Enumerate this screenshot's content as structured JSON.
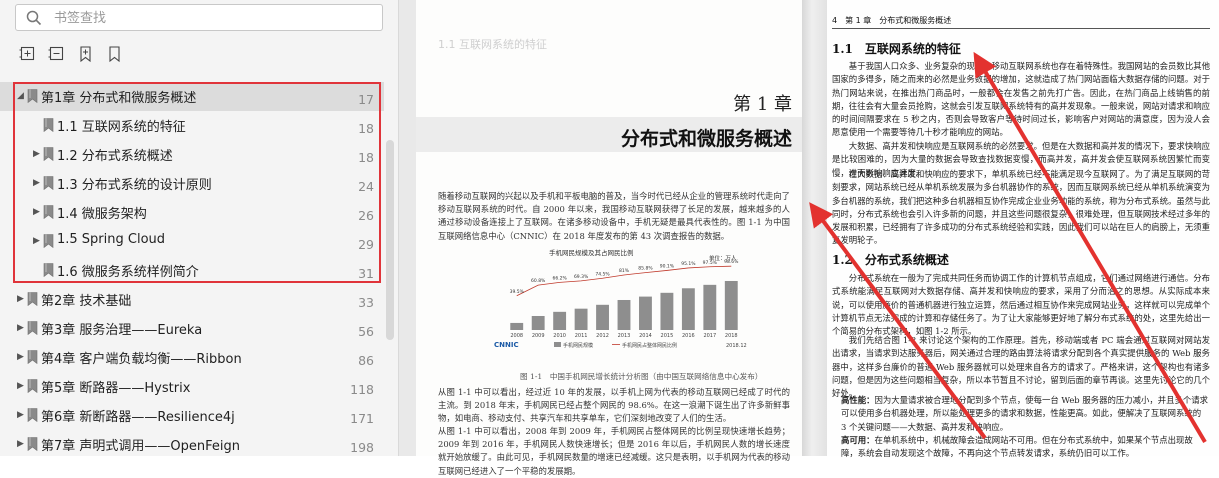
{
  "search": {
    "placeholder": "书签查找"
  },
  "toolbar": [
    {
      "icon": "expand-all-icon"
    },
    {
      "icon": "collapse-all-icon"
    },
    {
      "icon": "add-bookmark-icon"
    },
    {
      "icon": "bookmark-icon"
    }
  ],
  "toc": [
    {
      "label": "第1章 分布式和微服务概述",
      "page": "17",
      "level": 0,
      "expanded": true,
      "selected": true
    },
    {
      "label": "1.1 互联网系统的特征",
      "page": "18",
      "level": 1,
      "has_children": false
    },
    {
      "label": "1.2 分布式系统概述",
      "page": "18",
      "level": 1,
      "has_children": true
    },
    {
      "label": "1.3 分布式系统的设计原则",
      "page": "24",
      "level": 1,
      "has_children": true
    },
    {
      "label": "1.4 微服务架构",
      "page": "26",
      "level": 1,
      "has_children": true
    },
    {
      "label": "1.5 Spring Cloud",
      "page": "29",
      "level": 1,
      "has_children": true
    },
    {
      "label": "1.6 微服务系统样例简介",
      "page": "31",
      "level": 1,
      "has_children": false
    },
    {
      "label": "第2章 技术基础",
      "page": "33",
      "level": 0,
      "has_children": true
    },
    {
      "label": "第3章 服务治理——Eureka",
      "page": "56",
      "level": 0,
      "has_children": true
    },
    {
      "label": "第4章 客户端负载均衡——Ribbon",
      "page": "86",
      "level": 0,
      "has_children": true
    },
    {
      "label": "第5章 断路器——Hystrix",
      "page": "118",
      "level": 0,
      "has_children": true
    },
    {
      "label": "第6章 新断路器——Resilience4j",
      "page": "171",
      "level": 0,
      "has_children": true
    },
    {
      "label": "第7章 声明式调用——OpenFeign",
      "page": "198",
      "level": 0,
      "has_children": true
    }
  ],
  "colors": {
    "highlight": "#e0343a",
    "sidebar_bg": "#f4f4f4",
    "selected_row": "#dcdcdc"
  },
  "left_page": {
    "chapter_no": "第 1 章",
    "chapter_title": "分布式和微服务概述",
    "top_text": "1.1 互联网系统的特征",
    "intro": "随着移动互联网的兴起以及手机和平板电脑的普及，当今时代已经从企业的管理系统时代走向了移动互联网系统的时代。自 2000 年以来，我国移动互联网获得了长足的发展，越来越多的人通过移动设备连接上了互联网。在诸多移动设备中，手机无疑是最具代表性的。图 1-1 为中国互联网络信息中心（CNNIC）在 2018 年度发布的第 43 次调查报告的数据。",
    "chart_title": "手机网民规模及其占网民比例",
    "chart_unit": "单位：万人",
    "chart_logo": "CNNIC",
    "chart_legend": [
      "手机网民规模",
      "手机网民占整体网民比例"
    ],
    "chart_date": "2018.12",
    "figure_caption": "图 1-1　中国手机网民增长统计分析图（由中国互联网络信息中心发布）",
    "para2": "从图 1-1 中可以看出，经过近 10 年的发展，以手机上网为代表的移动互联网已经成了时代的主流。到 2018 年末，手机网民已经占整个网民的 98.6%。在这一浪潮下诞生出了许多新鲜事物，如电商、移动支付、共享汽车和共享单车，它们深刻地改变了人们的生活。",
    "para3": "从图 1-1 中可以看出，2008 年到 2009 年，手机网民占整体网民的比例呈现快速增长趋势；2009 年到 2016 年，手机网民人数快速增长；但是 2016 年以后，手机网民人数的增长速度就开始放缓了。由此可见，手机网民数量的增速已经减缓。这只是表明，以手机网为代表的移动互联网已经进入了一个平稳的发展期。"
  },
  "chart_data": {
    "type": "bar",
    "title": "手机网民规模及其占网民比例",
    "categories": [
      "2008",
      "2009",
      "2010",
      "2011",
      "2012",
      "2013",
      "2014",
      "2015",
      "2016",
      "2017",
      "2018"
    ],
    "series": [
      {
        "name": "手机网民规模",
        "values": [
          11760,
          23344,
          30274,
          35558,
          41997,
          50006,
          55678,
          61981,
          69531,
          75265,
          81698
        ]
      },
      {
        "name": "手机网民占整体网民比例",
        "values": [
          39.5,
          60.8,
          66.2,
          69.3,
          74.5,
          81.0,
          85.8,
          90.1,
          95.1,
          97.5,
          98.6
        ]
      }
    ]
  },
  "right_page": {
    "header": "4　第 1 章　分布式和微服务概述",
    "section1": "1.1　互联网系统的特征",
    "s1_p1": "基于我国人口众多、业务复杂的现状，移动互联网系统也存在着特殊性。我国网站的会员数比其他国家的多得多，随之而来的必然是业务数据的增加，这就造成了热门网站面临大数据存储的问题。对于热门网站来说，在推出热门商品时，一般都会在发售之前先打广告。因此，在热门商品上线销售的前期，往往会有大量会员抢购，这就会引发互联网系统特有的高并发现象。一般来说，网站对请求和响应的时间间隔要求在 5 秒之内，否则会导致客户等待时间过长，影响客户对网站的满意度，因为没人会愿意使用一个需要等待几十秒才能响应的网站。",
    "s1_p2": "大数据、高并发和快响应是互联网系统的必然要求。但是在大数据和高并发的情况下，要求快响应是比较困难的，因为大量的数据会导致查找数据变慢，而高并发，高并发会使互联网系统因繁忙而变慢，进而影响响应速度。",
    "s1_p3": "在大数据、高并发和快响应的要求下，单机系统已经不能满足现今互联网了。为了满足互联网的苛刻要求，网站系统已经从单机系统发展为多台机器协作的系统，因而互联网系统已经从单机系统演变为多台机器的系统，我们把这种多台机器相互协作完成企业业务功能的系统，称为分布式系统。虽然与此同时，分布式系统也会引入许多新的问题，并且这些问题很复杂，很难处理，但互联网技术经过多年的发展和积累，已经拥有了许多成功的分布式系统经验和实践，因此我们可以站在巨人的肩膀上，无须重复发明轮子。",
    "section2": "1.2　分布式系统概述",
    "s2_p1": "分布式系统在一般为了完成共同任务而协调工作的计算机节点组成，它们通过网络进行通信。分布式系统能满足互联网对大数据存储、高并发和快响应的要求，采用了分而治之的思想。从实际成本来说，可以使用廉价的普通机器进行独立运算，然后通过相互协作来完成网站业务，这样就可以完成单个计算机节点无法完成的计算和存储任务了。为了让大家能够更好地了解分布式系统的处，这里先给出一个简易的分布式架构，如图 1-2 所示。",
    "s2_p2": "我们先结合图 1-2 来讨论这个架构的工作原理。首先，移动端或者 PC 端会通过互联网对网站发出请求，当请求到达服务器后，网关通过合理的路由算法将请求分配到各个真实提供服务的 Web 服务器中，这样多台廉价的普通 Web 服务器就可以处理来自各方的请求了。严格来讲，这个架构也有诸多问题，但是因为这些问题相当复杂，所以本节暂且不讨论，留到后面的章节再谈。这里先讨论它的几个好处。",
    "bullet1_title": "高性能：",
    "bullet1": "因为大量请求被合理地分配到多个节点，使每一台 Web 服务器的压力减小，并且多个请求可以使用多台机器处理，所以能处理更多的请求和数据，性能更高。如此，便解决了互联网系统的 3 个关键问题——大数据、高并发和快响应。",
    "bullet2_title": "高可用：",
    "bullet2": "在单机系统中，机械故障会造成网站不可用。但在分布式系统中，如果某个节点出现故障，系统会自动发现这个故障，不再向这个节点转发请求，系统仍旧可以工作。"
  }
}
